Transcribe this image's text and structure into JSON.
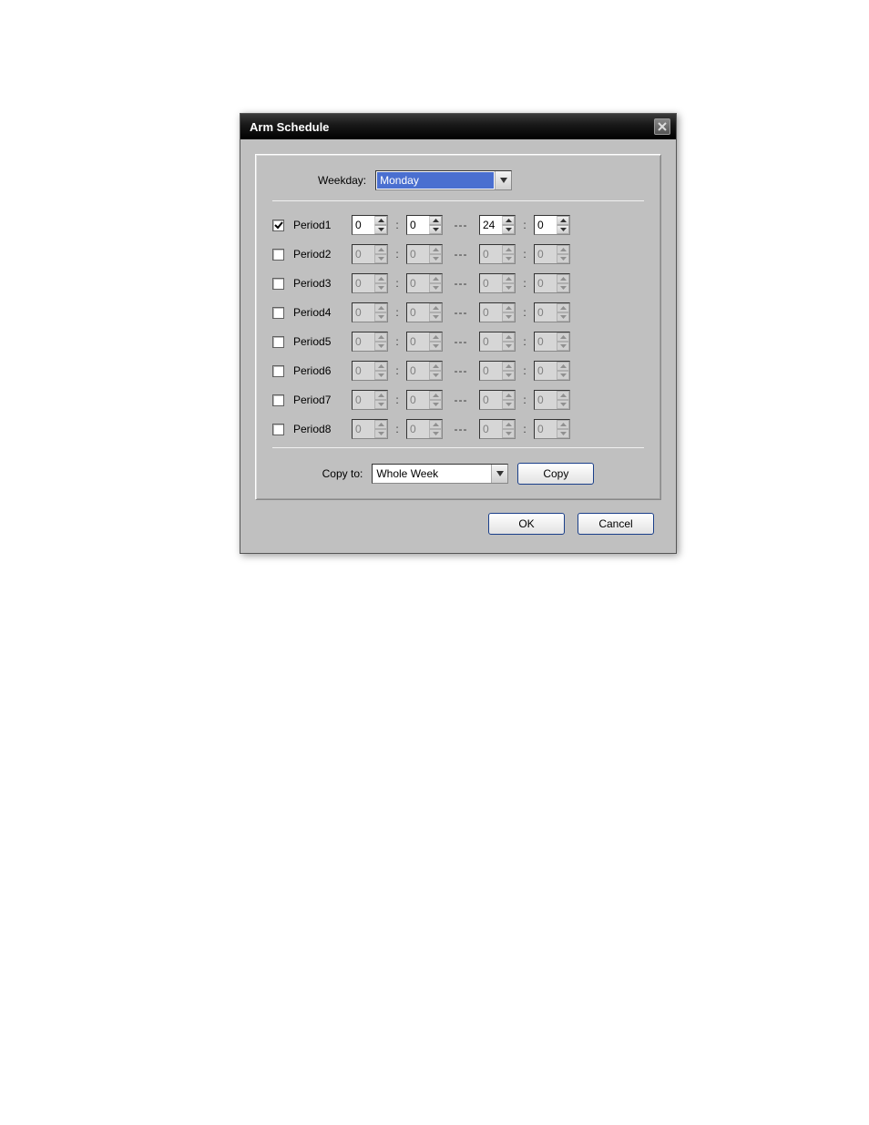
{
  "title": "Arm Schedule",
  "weekday": {
    "label": "Weekday:",
    "value": "Monday"
  },
  "periods": [
    {
      "name": "Period1",
      "enabled": true,
      "start_h": "0",
      "start_m": "0",
      "end_h": "24",
      "end_m": "0"
    },
    {
      "name": "Period2",
      "enabled": false,
      "start_h": "0",
      "start_m": "0",
      "end_h": "0",
      "end_m": "0"
    },
    {
      "name": "Period3",
      "enabled": false,
      "start_h": "0",
      "start_m": "0",
      "end_h": "0",
      "end_m": "0"
    },
    {
      "name": "Period4",
      "enabled": false,
      "start_h": "0",
      "start_m": "0",
      "end_h": "0",
      "end_m": "0"
    },
    {
      "name": "Period5",
      "enabled": false,
      "start_h": "0",
      "start_m": "0",
      "end_h": "0",
      "end_m": "0"
    },
    {
      "name": "Period6",
      "enabled": false,
      "start_h": "0",
      "start_m": "0",
      "end_h": "0",
      "end_m": "0"
    },
    {
      "name": "Period7",
      "enabled": false,
      "start_h": "0",
      "start_m": "0",
      "end_h": "0",
      "end_m": "0"
    },
    {
      "name": "Period8",
      "enabled": false,
      "start_h": "0",
      "start_m": "0",
      "end_h": "0",
      "end_m": "0"
    }
  ],
  "separator": "---",
  "colon": ":",
  "copy": {
    "label": "Copy to:",
    "value": "Whole Week",
    "button": "Copy"
  },
  "buttons": {
    "ok": "OK",
    "cancel": "Cancel"
  }
}
